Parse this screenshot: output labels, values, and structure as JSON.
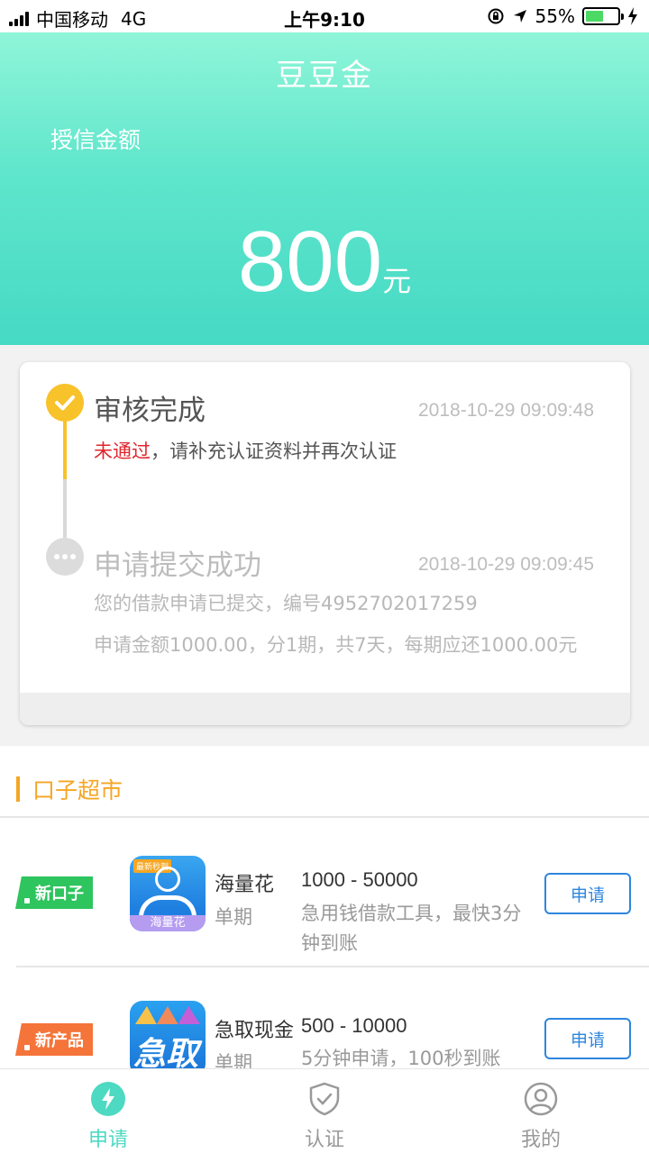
{
  "status_bar": {
    "carrier": "中国移动",
    "network": "4G",
    "time": "上午9:10",
    "battery": "55%",
    "battery_level": 0.55
  },
  "header": {
    "title": "豆豆金",
    "credit_label": "授信金额",
    "amount": "800",
    "unit": "元"
  },
  "progress": {
    "steps": [
      {
        "title": "审核完成",
        "time": "2018-10-29 09:09:48",
        "status": "未通过",
        "desc": "，请补充认证资料并再次认证"
      },
      {
        "title": "申请提交成功",
        "time": "2018-10-29 09:09:45",
        "desc1": "您的借款申请已提交，编号4952702017259",
        "desc2": "申请金额1000.00，分1期，共7天，每期应还1000.00元"
      }
    ]
  },
  "market": {
    "title": "口子超市",
    "items": [
      {
        "tag": "新口子",
        "icon_badge": "最新秒到",
        "icon_text": "海量花",
        "name": "海量花",
        "period": "单期",
        "range": "1000 - 50000",
        "desc": "急用钱借款工具，最快3分钟到账",
        "button": "申请"
      },
      {
        "tag": "新产品",
        "icon_text": "急取",
        "name": "急取现金",
        "period": "单期",
        "range": "500 - 10000",
        "desc": "5分钟申请，100秒到账",
        "button": "申请"
      }
    ]
  },
  "tabbar": {
    "tabs": [
      {
        "label": "申请",
        "icon": "lightning-icon",
        "active": true
      },
      {
        "label": "认证",
        "icon": "shield-check-icon",
        "active": false
      },
      {
        "label": "我的",
        "icon": "user-icon",
        "active": false
      }
    ],
    "accent_color": "#4dd9c2"
  }
}
